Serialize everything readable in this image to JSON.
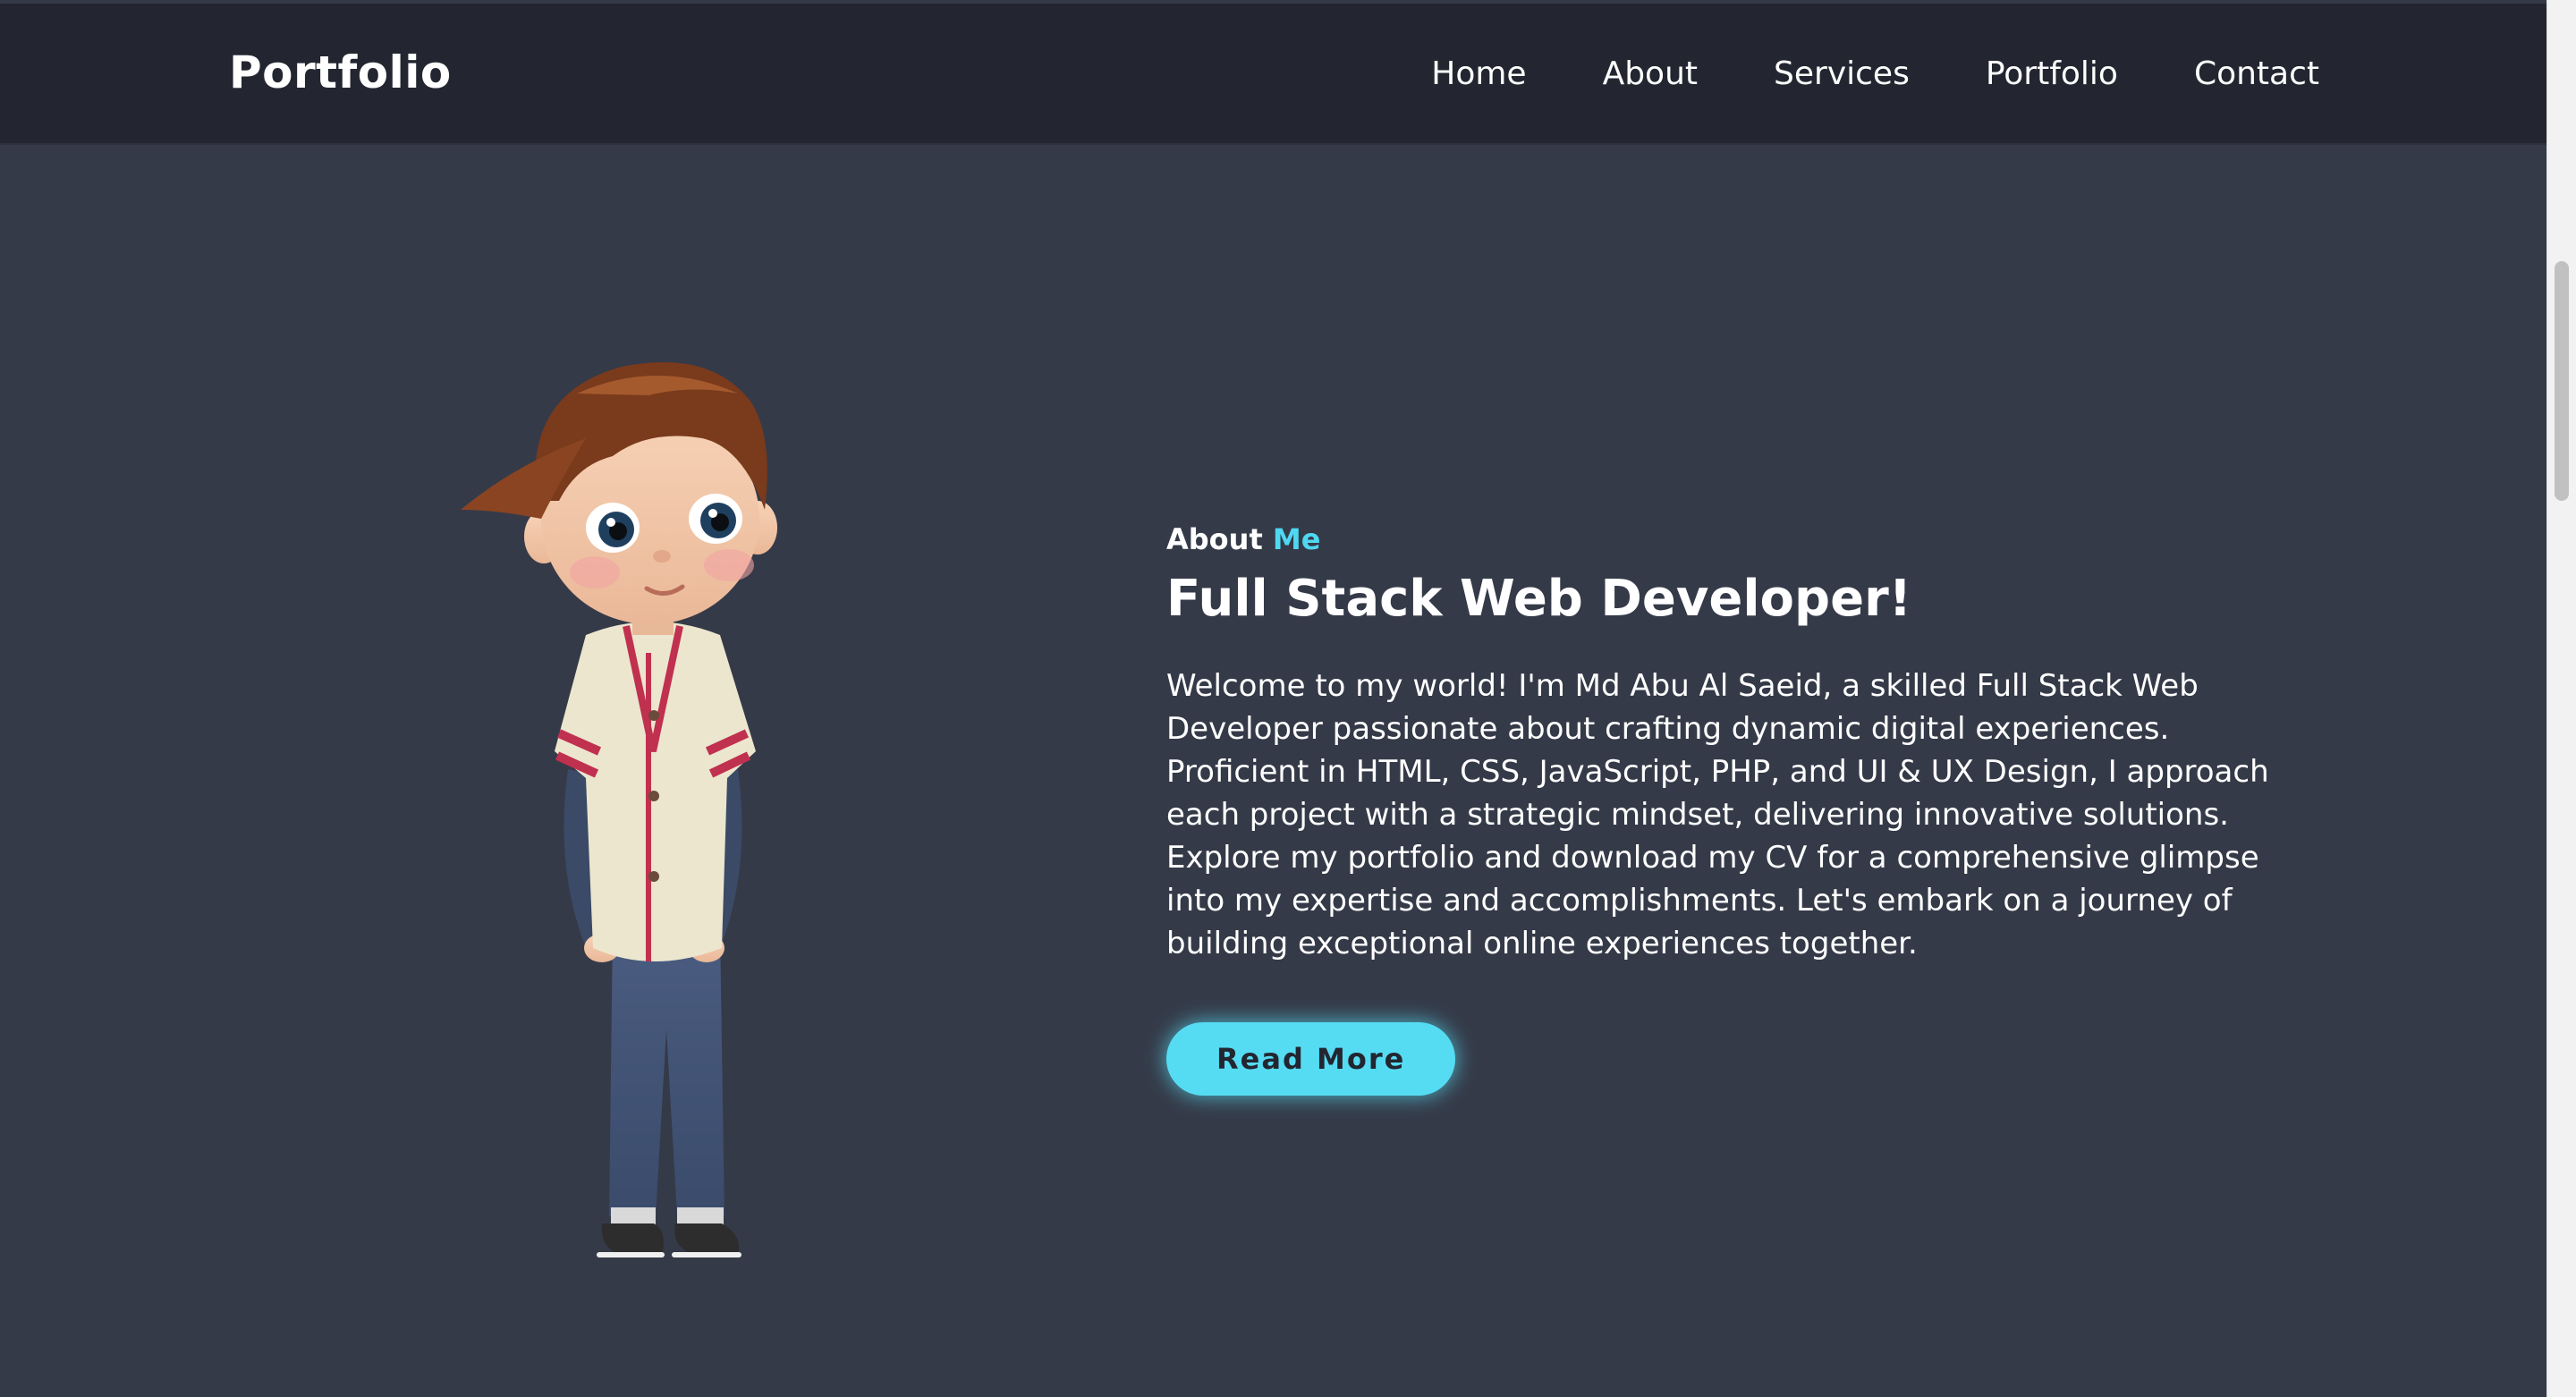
{
  "header": {
    "brand": "Portfolio",
    "nav": [
      "Home",
      "About",
      "Services",
      "Portfolio",
      "Contact"
    ]
  },
  "about": {
    "eyebrow_main": "About",
    "eyebrow_accent": "Me",
    "title": "Full Stack Web Developer!",
    "description": "Welcome to my world! I'm Md Abu Al Saeid, a skilled Full Stack Web Developer passionate about crafting dynamic digital experiences. Proficient in HTML, CSS, JavaScript, PHP, and UI & UX Design, I approach each project with a strategic mindset, delivering innovative solutions. Explore my portfolio and download my CV for a comprehensive glimpse into my expertise and accomplishments. Let's embark on a journey of building exceptional online experiences together.",
    "button": "Read More"
  },
  "colors": {
    "background": "#353a48",
    "header": "#232630",
    "accent": "#4fd8f1"
  }
}
